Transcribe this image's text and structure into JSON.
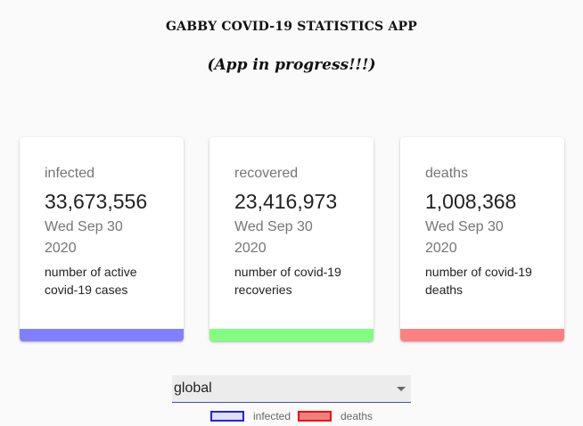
{
  "header": {
    "title": "GABBY COVID-19 STATISTICS APP",
    "subtitle": "(App in progress!!!)"
  },
  "cards": [
    {
      "label": "infected",
      "value": "33,673,556",
      "date": "Wed Sep 30 2020",
      "description": "number of active covid-19 cases",
      "color": "#8080ff"
    },
    {
      "label": "recovered",
      "value": "23,416,973",
      "date": "Wed Sep 30 2020",
      "description": "number of covid-19 recoveries",
      "color": "#80ff80"
    },
    {
      "label": "deaths",
      "value": "1,008,368",
      "date": "Wed Sep 30 2020",
      "description": "number of covid-19 deaths",
      "color": "#ff8080"
    }
  ],
  "country_select": {
    "selected": "global",
    "underline_color": "#3f51b5"
  },
  "legend": [
    {
      "label": "infected",
      "fill": "#e0e0f0",
      "border": "#2222ee"
    },
    {
      "label": "deaths",
      "fill": "#f08080",
      "border": "#ee1111"
    }
  ]
}
